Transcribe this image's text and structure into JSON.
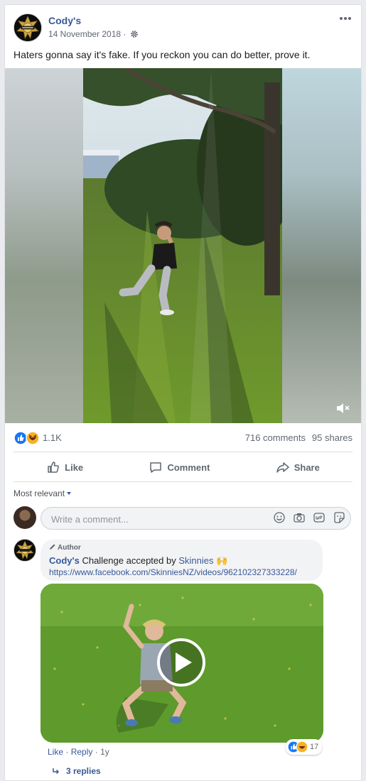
{
  "post": {
    "page_name": "Cody's",
    "date": "14 November 2018 ·",
    "text": "Haters gonna say it's fake. If you reckon you can do better, prove it."
  },
  "stats": {
    "reactions": "1.1K",
    "comments": "716 comments",
    "shares": "95 shares"
  },
  "actions": {
    "like": "Like",
    "comment": "Comment",
    "share": "Share"
  },
  "comments_section": {
    "sort_label": "Most relevant",
    "input_placeholder": "Write a comment..."
  },
  "comment": {
    "author_tag": "Author",
    "author": "Cody's",
    "text_middle": "Challenge accepted by",
    "mention": "Skinnies",
    "emoji": "🙌",
    "url": "https://www.facebook.com/SkinniesNZ/videos/962102327333228/",
    "like_label": "Like",
    "reply_label": "Reply",
    "age": "1y",
    "reaction_count": "17",
    "replies_label": "3 replies"
  },
  "colors": {
    "link": "#385898",
    "like_blue": "#1877f2",
    "haha_yellow": "#f7b125",
    "background": "#e9ebee"
  }
}
